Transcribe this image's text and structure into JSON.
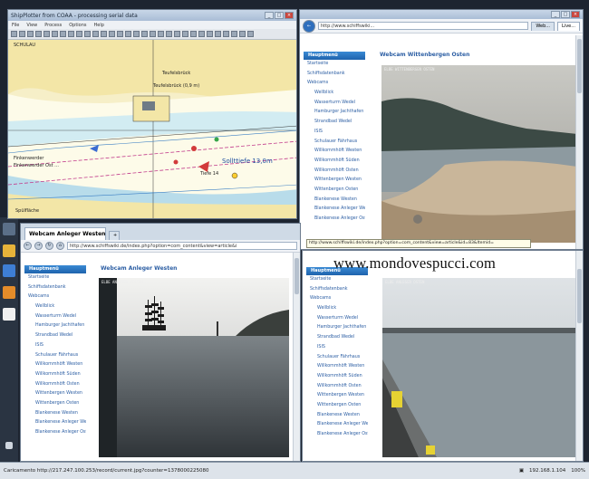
{
  "shipplotter": {
    "title": "ShipPlotter from COAA - processing serial data",
    "menu": [
      "File",
      "View",
      "Process",
      "Options",
      "Help"
    ],
    "map_labels": [
      {
        "text": "SCHULAU"
      },
      {
        "text": "Teufelsbrück"
      },
      {
        "text": "Teufelsbrück (0,9 m)"
      },
      {
        "text": "Finkenwerder"
      },
      {
        "text": "Spülfläche"
      },
      {
        "text": "Sollttiefe 13,0m"
      },
      {
        "text": "Tiefe 14"
      },
      {
        "text": "Finkenwerder Ost ..."
      }
    ]
  },
  "browser_right": {
    "url": "http://www.schiffswiki...",
    "tabs": [
      "Web...",
      "Live..."
    ],
    "page_heading": "Webcam Wittenbergen Osten",
    "cam_stamp": "ELBE WITTENBERGEN OSTEN"
  },
  "browser_left": {
    "tab_label": "Webcam Anleger Westen",
    "url": "http://www.schiffswiki.de/index.php?option=com_content&view=article&i",
    "page_heading": "Webcam Anleger Westen",
    "cam_stamp": "ELBE ANLEGER WESTEN"
  },
  "menu_head": "Hauptmenü",
  "nav_items": [
    {
      "label": "Startseite",
      "level": 1
    },
    {
      "label": "Schiffsdatenbank",
      "level": 1
    },
    {
      "label": "Webcams",
      "level": 1
    },
    {
      "label": "Wellblick",
      "level": 2
    },
    {
      "label": "Wasserturm Wedel",
      "level": 2
    },
    {
      "label": "Hamburger Jachthafen",
      "level": 2
    },
    {
      "label": "Strandbad Wedel",
      "level": 2
    },
    {
      "label": "ISIS",
      "level": 2
    },
    {
      "label": "Schulauer Fährhaus",
      "level": 2
    },
    {
      "label": "Willkommhöft Westen",
      "level": 2
    },
    {
      "label": "Willkommhöft Süden",
      "level": 2
    },
    {
      "label": "Willkommhöft Osten",
      "level": 2
    },
    {
      "label": "Wittenbergen Westen",
      "level": 2
    },
    {
      "label": "Wittenbergen Osten",
      "level": 2
    },
    {
      "label": "Blankenese Westen",
      "level": 2
    },
    {
      "label": "Blankenese Anleger Westen",
      "level": 2
    },
    {
      "label": "Blankenese Anleger Osten",
      "level": 2
    }
  ],
  "tooltip": "http://www.schiffswiki.de/index.php?option=com_content&view=article&id=83&Itemid=",
  "watermark": "www.mondovespucci.com",
  "status": {
    "left": "Caricamento http://217.247.100.253/record/current.jpg?counter=1378000225080",
    "ip": "192.168.1.104",
    "zoom": "100%"
  },
  "bottom_right_cam_stamp": "ELBE ANLEGER OSTEN"
}
